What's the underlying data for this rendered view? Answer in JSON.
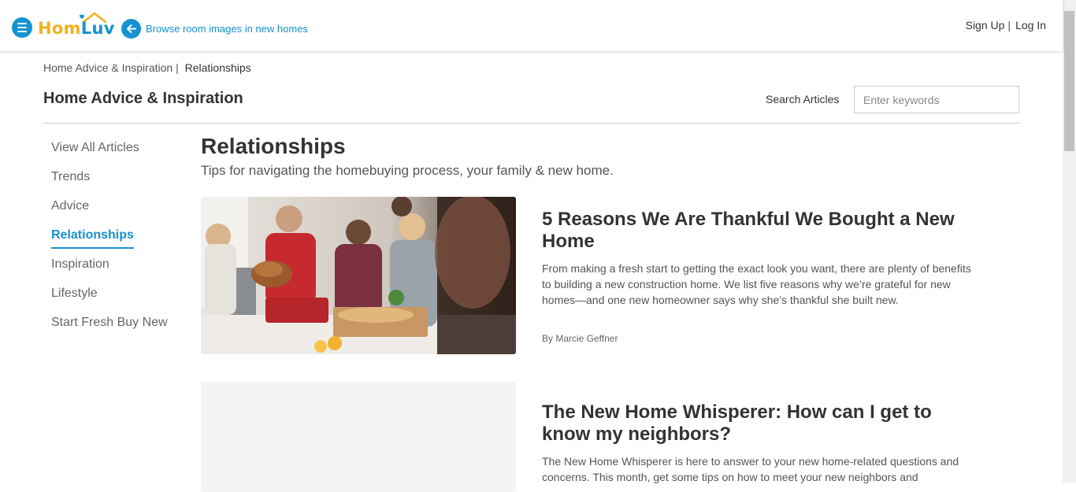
{
  "header": {
    "logo_hom": "Hom",
    "logo_luv": "Luv",
    "back_link": "Browse room images in new homes",
    "sign_up": "Sign Up",
    "separator": "|",
    "log_in": "Log In"
  },
  "breadcrumb": {
    "parent": "Home Advice & Inspiration",
    "separator": "|",
    "current": "Relationships"
  },
  "page_title": "Home Advice & Inspiration",
  "search": {
    "label": "Search Articles",
    "placeholder": "Enter keywords"
  },
  "sidebar": {
    "items": [
      {
        "label": "View All Articles",
        "active": false
      },
      {
        "label": "Trends",
        "active": false
      },
      {
        "label": "Advice",
        "active": false
      },
      {
        "label": "Relationships",
        "active": true
      },
      {
        "label": "Inspiration",
        "active": false
      },
      {
        "label": "Lifestyle",
        "active": false
      },
      {
        "label": "Start Fresh Buy New",
        "active": false
      }
    ]
  },
  "section": {
    "title": "Relationships",
    "subtitle": "Tips for navigating the homebuying process, your family & new home."
  },
  "articles": [
    {
      "title": "5 Reasons We Are Thankful We Bought a New Home",
      "description": "From making a fresh start to getting the exact look you want, there are plenty of benefits to building a new construction home. We list five reasons why we’re grateful for new homes—and one new homeowner says why she’s thankful she built new.",
      "author": "By Marcie Geffner"
    },
    {
      "title": "The New Home Whisperer: How can I get to know my neighbors?",
      "description": "The New Home Whisperer is here to answer to your new home-related questions and concerns. This month, get some tips on how to meet your new neighbors and"
    }
  ],
  "colors": {
    "brand_blue": "#1592d1",
    "brand_yellow": "#f2b21b"
  }
}
